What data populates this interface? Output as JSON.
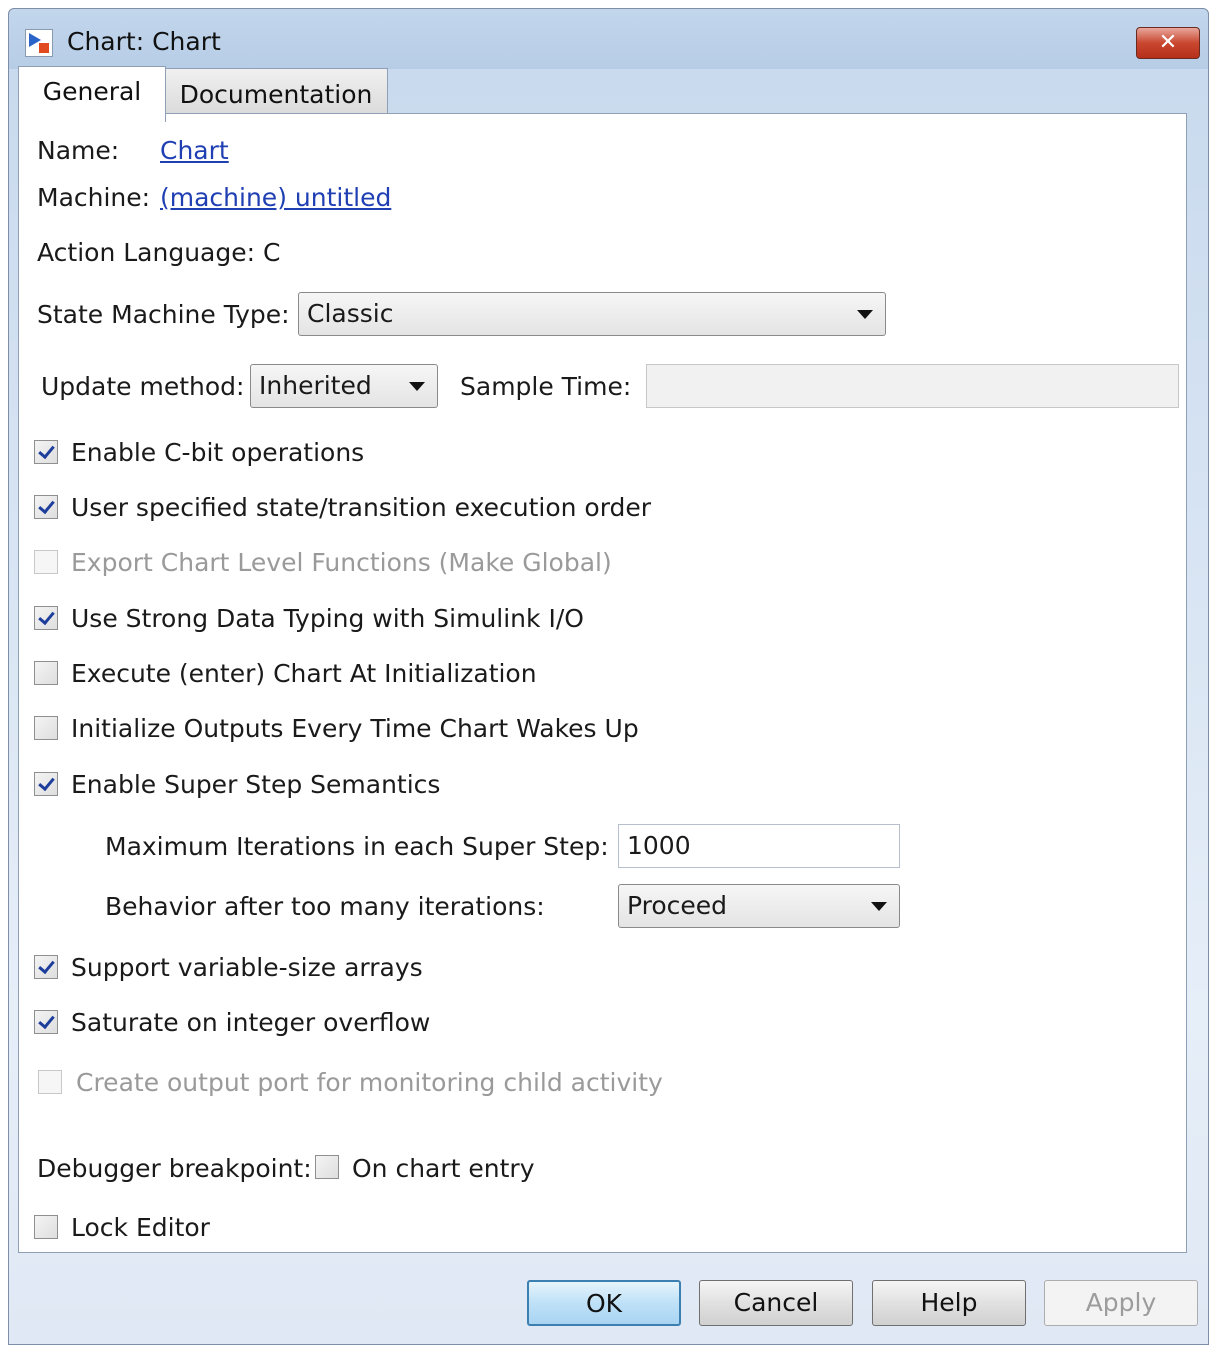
{
  "window": {
    "title": "Chart: Chart",
    "close_label": "✕"
  },
  "tabs": [
    {
      "label": "General",
      "selected": true
    },
    {
      "label": "Documentation",
      "selected": false
    }
  ],
  "general": {
    "name_label": "Name:",
    "name_value": "Chart",
    "machine_label": "Machine:",
    "machine_value": "(machine) untitled",
    "action_language": "Action Language:  C",
    "state_machine_type_label": "State Machine Type:",
    "state_machine_type_value": "Classic",
    "update_method_label": "Update method:",
    "update_method_value": "Inherited",
    "sample_time_label": "Sample Time:",
    "sample_time_value": "",
    "options": [
      {
        "label": "Enable C-bit operations",
        "checked": true,
        "enabled": true
      },
      {
        "label": "User specified state/transition execution order",
        "checked": true,
        "enabled": true
      },
      {
        "label": "Export Chart Level Functions (Make Global)",
        "checked": false,
        "enabled": false
      },
      {
        "label": "Use Strong Data Typing with Simulink I/O",
        "checked": true,
        "enabled": true
      },
      {
        "label": "Execute (enter) Chart At Initialization",
        "checked": false,
        "enabled": true
      },
      {
        "label": "Initialize Outputs Every Time Chart Wakes Up",
        "checked": false,
        "enabled": true
      },
      {
        "label": "Enable Super Step Semantics",
        "checked": true,
        "enabled": true
      }
    ],
    "max_iterations_label": "Maximum Iterations in each Super Step:",
    "max_iterations_value": "1000",
    "behavior_label": "Behavior after too many iterations:",
    "behavior_value": "Proceed",
    "options2": [
      {
        "label": "Support variable-size arrays",
        "checked": true,
        "enabled": true
      },
      {
        "label": "Saturate on integer overflow",
        "checked": true,
        "enabled": true
      },
      {
        "label": "Create output port for monitoring child activity",
        "checked": false,
        "enabled": false
      }
    ],
    "debugger_label": "Debugger breakpoint:",
    "on_chart_entry_label": "On chart entry",
    "on_chart_entry_checked": false,
    "lock_editor_label": "Lock Editor",
    "lock_editor_checked": false
  },
  "buttons": {
    "ok": "OK",
    "cancel": "Cancel",
    "help": "Help",
    "apply": "Apply",
    "apply_enabled": false
  }
}
